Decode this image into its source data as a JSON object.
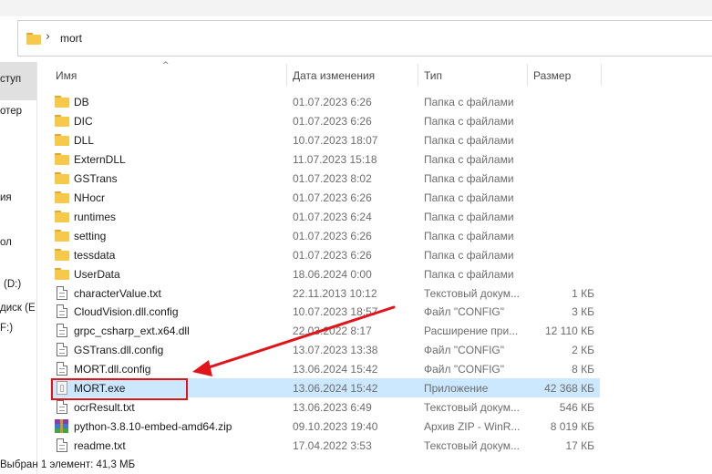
{
  "address_bar": {
    "path_segment": "mort",
    "chevron": "›"
  },
  "nav_pane": {
    "items": [
      {
        "label": "ступ",
        "selected": true
      },
      {
        "label": "отер"
      },
      {
        "label": "ия"
      },
      {
        "label": "ол"
      },
      {
        "label": "(D:)"
      },
      {
        "label": "диск (E"
      },
      {
        "label": "F:)"
      }
    ]
  },
  "columns": {
    "name": "Имя",
    "date": "Дата изменения",
    "type": "Тип",
    "size": "Размер",
    "sort_indicator": "^"
  },
  "files": [
    {
      "name": "DB",
      "date": "01.07.2023 6:26",
      "type": "Папка с файлами",
      "size": "",
      "icon": "folder-icon"
    },
    {
      "name": "DIC",
      "date": "01.07.2023 6:26",
      "type": "Папка с файлами",
      "size": "",
      "icon": "folder-icon"
    },
    {
      "name": "DLL",
      "date": "10.07.2023 18:07",
      "type": "Папка с файлами",
      "size": "",
      "icon": "folder-icon"
    },
    {
      "name": "ExternDLL",
      "date": "11.07.2023 15:18",
      "type": "Папка с файлами",
      "size": "",
      "icon": "folder-icon"
    },
    {
      "name": "GSTrans",
      "date": "01.07.2023 8:02",
      "type": "Папка с файлами",
      "size": "",
      "icon": "folder-icon"
    },
    {
      "name": "NHocr",
      "date": "01.07.2023 6:26",
      "type": "Папка с файлами",
      "size": "",
      "icon": "folder-icon"
    },
    {
      "name": "runtimes",
      "date": "01.07.2023 6:24",
      "type": "Папка с файлами",
      "size": "",
      "icon": "folder-icon"
    },
    {
      "name": "setting",
      "date": "01.07.2023 6:26",
      "type": "Папка с файлами",
      "size": "",
      "icon": "folder-icon"
    },
    {
      "name": "tessdata",
      "date": "01.07.2023 6:26",
      "type": "Папка с файлами",
      "size": "",
      "icon": "folder-icon"
    },
    {
      "name": "UserData",
      "date": "18.06.2024 0:00",
      "type": "Папка с файлами",
      "size": "",
      "icon": "folder-icon"
    },
    {
      "name": "characterValue.txt",
      "date": "22.11.2013 10:12",
      "type": "Текстовый докум...",
      "size": "1 КБ",
      "icon": "text-file-icon"
    },
    {
      "name": "CloudVision.dll.config",
      "date": "10.07.2023 18:57",
      "type": "Файл \"CONFIG\"",
      "size": "3 КБ",
      "icon": "config-file-icon"
    },
    {
      "name": "grpc_csharp_ext.x64.dll",
      "date": "22.03.2022 8:17",
      "type": "Расширение при...",
      "size": "12 110 КБ",
      "icon": "dll-file-icon"
    },
    {
      "name": "GSTrans.dll.config",
      "date": "13.07.2023 13:38",
      "type": "Файл \"CONFIG\"",
      "size": "2 КБ",
      "icon": "config-file-icon"
    },
    {
      "name": "MORT.dll.config",
      "date": "13.06.2024 15:42",
      "type": "Файл \"CONFIG\"",
      "size": "8 КБ",
      "icon": "config-file-icon"
    },
    {
      "name": "MORT.exe",
      "date": "13.06.2024 15:42",
      "type": "Приложение",
      "size": "42 368 КБ",
      "icon": "exe-file-icon",
      "selected": true
    },
    {
      "name": "ocrResult.txt",
      "date": "13.06.2023 6:49",
      "type": "Текстовый докум...",
      "size": "546 КБ",
      "icon": "text-file-icon"
    },
    {
      "name": "python-3.8.10-embed-amd64.zip",
      "date": "09.10.2023 19:40",
      "type": "Архив ZIP - WinR...",
      "size": "8 019 КБ",
      "icon": "winrar-zip-icon"
    },
    {
      "name": "readme.txt",
      "date": "17.04.2022 3:53",
      "type": "Текстовый докум...",
      "size": "17 КБ",
      "icon": "text-file-icon"
    }
  ],
  "status_bar": {
    "text": "Выбран 1 элемент: 41,3 МБ"
  },
  "annotation": {
    "color": "#e0141a",
    "target": "MORT.exe"
  }
}
